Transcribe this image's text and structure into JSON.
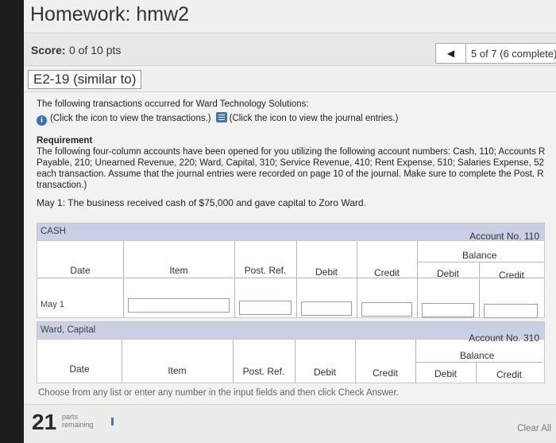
{
  "header": {
    "title": "Homework: hmw2",
    "score_label": "Score:",
    "score_value": "0 of 10 pts",
    "nav_prev": "◀",
    "nav_status": "5 of 7 (6 complete)"
  },
  "question": {
    "id": "E2-19 (similar to)",
    "intro": "The following transactions occurred for Ward Technology Solutions:",
    "link_transactions": "(Click the icon to view the transactions.)",
    "link_journal": "(Click the icon to view the journal entries.)",
    "requirement_heading": "Requirement",
    "requirement_text": "The following four-column accounts have been opened for you utilizing the following account numbers: Cash, 110; Accounts R Payable, 210; Unearned Revenue, 220; Ward, Capital, 310; Service Revenue, 410; Rent Expense, 510; Salaries Expense, 52 each transaction. Assume that the journal entries were recorded on page 10 of the journal. Make sure to complete the Post. R transaction.)",
    "transaction": "May 1: The business received cash of $75,000 and gave capital to Zoro Ward."
  },
  "ledgers": [
    {
      "name": "CASH",
      "account_no": "Account No. 110",
      "balance": "Balance",
      "columns": [
        "Date",
        "Item",
        "Post. Ref.",
        "Debit",
        "Credit",
        "Debit",
        "Credit"
      ],
      "rows": [
        {
          "date": "May 1"
        }
      ]
    },
    {
      "name": "Ward, Capital",
      "account_no": "Account No. 310",
      "balance": "Balance",
      "columns": [
        "Date",
        "Item",
        "Post. Ref.",
        "Debit",
        "Credit",
        "Debit",
        "Credit"
      ]
    }
  ],
  "footer": {
    "instruction": "Choose from any list or enter any number in the input fields and then click Check Answer.",
    "parts_count": "21",
    "parts_label_1": "parts",
    "parts_label_2": "remaining",
    "clear_all": "Clear All"
  },
  "colors": {
    "ledger_header": "#c9cfe4",
    "info_icon": "#2f77b8"
  }
}
